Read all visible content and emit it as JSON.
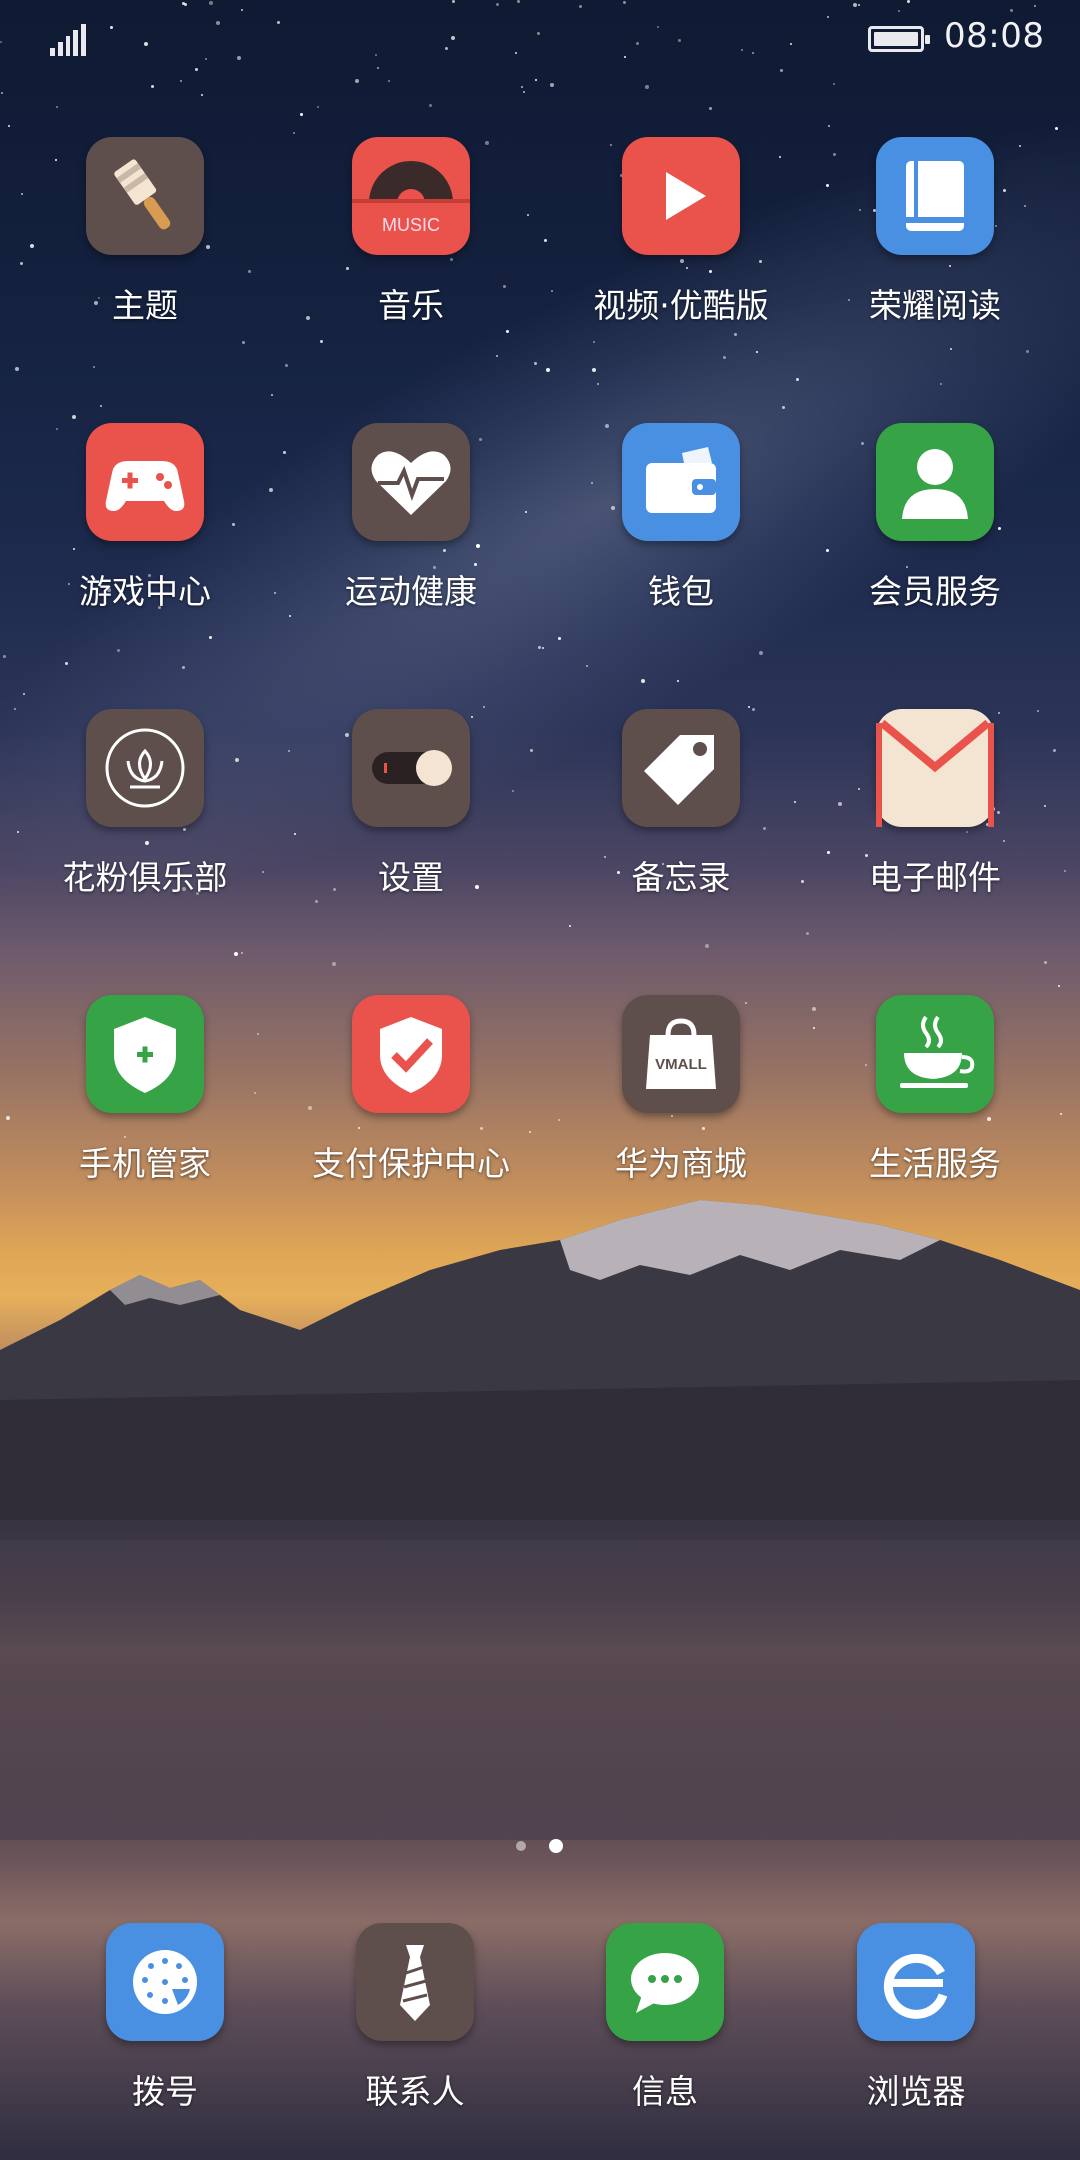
{
  "status_bar": {
    "signal_icon": "signal-bars-icon",
    "battery_icon": "battery-full-icon",
    "battery_level": 1.0,
    "time": "08:08"
  },
  "apps": [
    {
      "label": "主题",
      "icon": "paintbrush-icon",
      "color": "#5e4f4c"
    },
    {
      "label": "音乐",
      "icon": "music-disc-icon",
      "color": "#e9534b",
      "icon_text": "MUSIC"
    },
    {
      "label": "视频·优酷版",
      "icon": "play-icon",
      "color": "#e9534b"
    },
    {
      "label": "荣耀阅读",
      "icon": "book-icon",
      "color": "#4a90e2"
    },
    {
      "label": "游戏中心",
      "icon": "gamepad-icon",
      "color": "#e9534b"
    },
    {
      "label": "运动健康",
      "icon": "heart-pulse-icon",
      "color": "#5e4f4c"
    },
    {
      "label": "钱包",
      "icon": "wallet-icon",
      "color": "#4a90e2"
    },
    {
      "label": "会员服务",
      "icon": "person-icon",
      "color": "#35a346"
    },
    {
      "label": "花粉俱乐部",
      "icon": "lotus-icon",
      "color": "#5e4f4c"
    },
    {
      "label": "设置",
      "icon": "toggle-icon",
      "color": "#5e4f4c"
    },
    {
      "label": "备忘录",
      "icon": "tag-icon",
      "color": "#5e4f4c"
    },
    {
      "label": "电子邮件",
      "icon": "envelope-icon",
      "color": "#f4e4d2"
    },
    {
      "label": "手机管家",
      "icon": "shield-plus-icon",
      "color": "#35a346"
    },
    {
      "label": "支付保护中心",
      "icon": "shield-check-icon",
      "color": "#e9534b"
    },
    {
      "label": "华为商城",
      "icon": "shopping-bag-icon",
      "color": "#5e4f4c",
      "icon_text": "VMALL"
    },
    {
      "label": "生活服务",
      "icon": "coffee-cup-icon",
      "color": "#35a346"
    }
  ],
  "page_indicator": {
    "pages": 2,
    "current": 2
  },
  "dock": [
    {
      "label": "拨号",
      "icon": "dialpad-icon",
      "color": "#4a90e2"
    },
    {
      "label": "联系人",
      "icon": "tie-icon",
      "color": "#5e4f4c"
    },
    {
      "label": "信息",
      "icon": "chat-bubble-icon",
      "color": "#35a346"
    },
    {
      "label": "浏览器",
      "icon": "browser-e-icon",
      "color": "#4a90e2"
    }
  ]
}
